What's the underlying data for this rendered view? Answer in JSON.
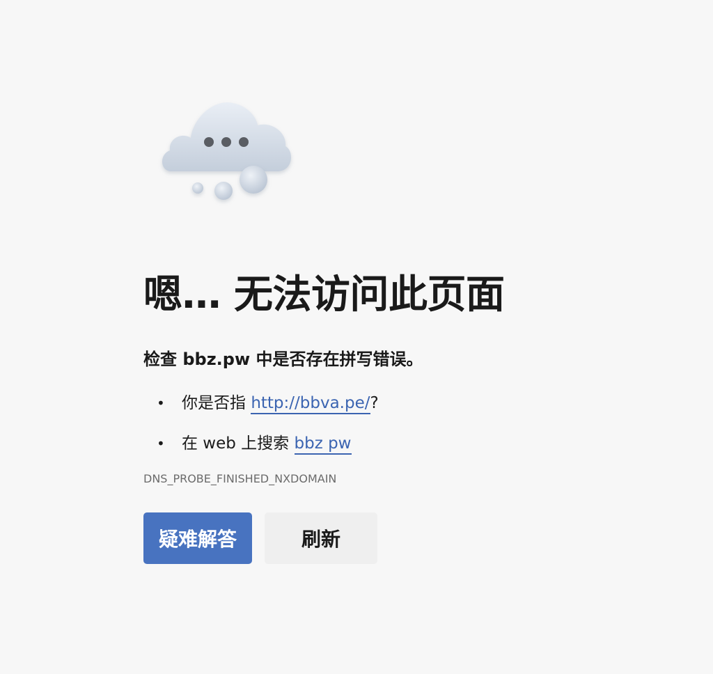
{
  "error_page": {
    "illustration_icon": "thinking-cloud-icon",
    "title": "嗯… 无法访问此页面",
    "subtitle": "检查 bbz.pw 中是否存在拼写错误。",
    "suggestions": [
      {
        "prefix": "你是否指 ",
        "link_text": "http://bbva.pe/",
        "suffix": "?"
      },
      {
        "prefix": "在 web 上搜索 ",
        "link_text": "bbz pw",
        "suffix": ""
      }
    ],
    "bullet": "•",
    "error_code": "DNS_PROBE_FINISHED_NXDOMAIN",
    "buttons": {
      "troubleshoot": "疑难解答",
      "refresh": "刷新"
    }
  },
  "colors": {
    "background": "#f7f7f7",
    "link": "#3b64b1",
    "primary_button": "#4873c0",
    "secondary_button": "#efefef"
  }
}
